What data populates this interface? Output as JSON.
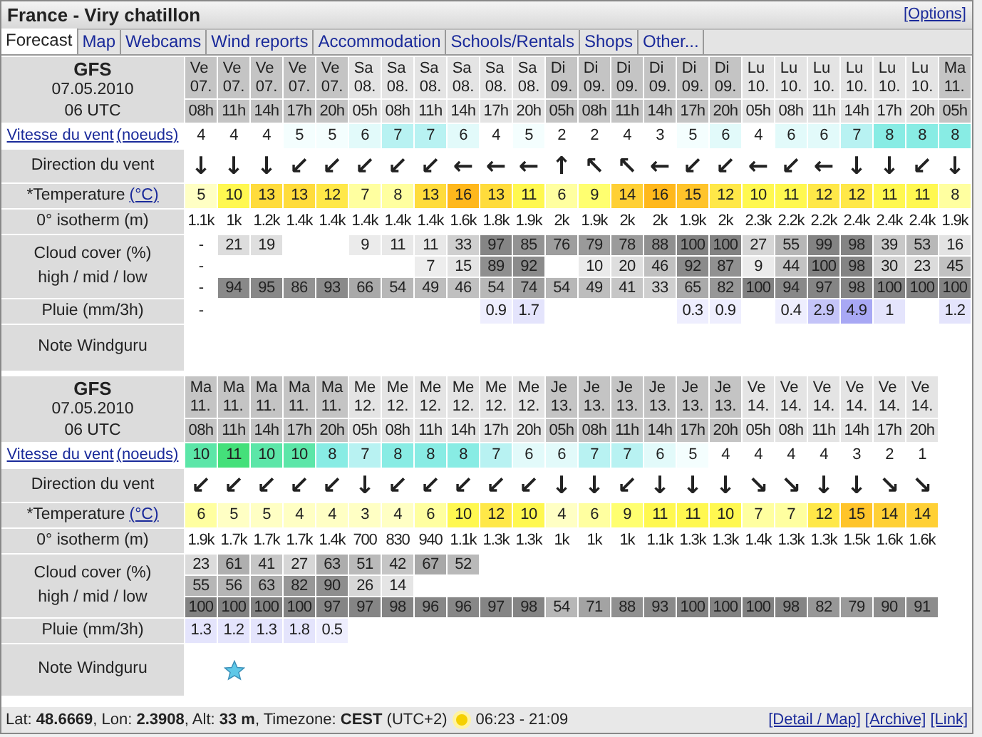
{
  "title": "France - Viry chatillon",
  "options_link": "[Options]",
  "tabs": [
    {
      "label": "Forecast",
      "selected": true
    },
    {
      "label": "Map",
      "selected": false
    },
    {
      "label": "Webcams",
      "selected": false
    },
    {
      "label": "Wind reports",
      "selected": false
    },
    {
      "label": "Accommodation",
      "selected": false
    },
    {
      "label": "Schools/Rentals",
      "selected": false
    },
    {
      "label": "Shops",
      "selected": false
    },
    {
      "label": "Other...",
      "selected": false
    }
  ],
  "blocks": [
    {
      "model": "GFS",
      "date": "07.05.2010",
      "run": "06 UTC",
      "labels": {
        "wind_speed": "Vitesse du vent",
        "wind_unit": "(noeuds)",
        "wind_direction": "Direction du vent",
        "temperature": "*Temperature",
        "temperature_unit": "(°C)",
        "isotherm": "0° isotherm (m)",
        "cloud": "Cloud cover (%)",
        "cloud_levels": "high / mid / low",
        "rain": "Pluie (mm/3h)",
        "note": "Note Windguru"
      },
      "columns": [
        {
          "day": "Ve",
          "date": "07.",
          "hour": "08h",
          "wind_speed": "4",
          "arrow": "↓",
          "temperature": "5",
          "isotherm": "1.1k",
          "cloud_high": "-",
          "cloud_mid": "-",
          "cloud_low": "-",
          "rain": "-"
        },
        {
          "day": "Ve",
          "date": "07.",
          "hour": "11h",
          "wind_speed": "4",
          "arrow": "↓",
          "temperature": "10",
          "isotherm": "1k",
          "cloud_high": "21",
          "cloud_low": "94"
        },
        {
          "day": "Ve",
          "date": "07.",
          "hour": "14h",
          "wind_speed": "4",
          "arrow": "↓",
          "temperature": "13",
          "isotherm": "1.2k",
          "cloud_high": "19",
          "cloud_low": "95"
        },
        {
          "day": "Ve",
          "date": "07.",
          "hour": "17h",
          "wind_speed": "5",
          "arrow": "↙",
          "temperature": "13",
          "isotherm": "1.4k",
          "cloud_low": "86"
        },
        {
          "day": "Ve",
          "date": "07.",
          "hour": "20h",
          "wind_speed": "5",
          "arrow": "↙",
          "temperature": "12",
          "isotherm": "1.4k",
          "cloud_low": "93"
        },
        {
          "day": "Sa",
          "date": "08.",
          "hour": "05h",
          "wind_speed": "6",
          "arrow": "↙",
          "temperature": "7",
          "isotherm": "1.4k",
          "cloud_high": "9",
          "cloud_low": "66"
        },
        {
          "day": "Sa",
          "date": "08.",
          "hour": "08h",
          "wind_speed": "7",
          "arrow": "↙",
          "temperature": "8",
          "isotherm": "1.4k",
          "cloud_high": "11",
          "cloud_low": "54"
        },
        {
          "day": "Sa",
          "date": "08.",
          "hour": "11h",
          "wind_speed": "7",
          "arrow": "↙",
          "temperature": "13",
          "isotherm": "1.4k",
          "cloud_high": "11",
          "cloud_mid": "7",
          "cloud_low": "49"
        },
        {
          "day": "Sa",
          "date": "08.",
          "hour": "14h",
          "wind_speed": "6",
          "arrow": "←",
          "temperature": "16",
          "isotherm": "1.6k",
          "cloud_high": "33",
          "cloud_mid": "15",
          "cloud_low": "46"
        },
        {
          "day": "Sa",
          "date": "08.",
          "hour": "17h",
          "wind_speed": "4",
          "arrow": "←",
          "temperature": "13",
          "isotherm": "1.8k",
          "cloud_high": "97",
          "cloud_mid": "89",
          "cloud_low": "54",
          "rain": "0.9"
        },
        {
          "day": "Sa",
          "date": "08.",
          "hour": "20h",
          "wind_speed": "5",
          "arrow": "←",
          "temperature": "11",
          "isotherm": "1.9k",
          "cloud_high": "85",
          "cloud_mid": "92",
          "cloud_low": "74",
          "rain": "1.7"
        },
        {
          "day": "Di",
          "date": "09.",
          "hour": "05h",
          "wind_speed": "2",
          "arrow": "↑",
          "temperature": "6",
          "isotherm": "2k",
          "cloud_high": "76",
          "cloud_low": "54"
        },
        {
          "day": "Di",
          "date": "09.",
          "hour": "08h",
          "wind_speed": "2",
          "arrow": "↖",
          "temperature": "9",
          "isotherm": "1.9k",
          "cloud_high": "79",
          "cloud_mid": "10",
          "cloud_low": "49"
        },
        {
          "day": "Di",
          "date": "09.",
          "hour": "11h",
          "wind_speed": "4",
          "arrow": "↖",
          "temperature": "14",
          "isotherm": "2k",
          "cloud_high": "78",
          "cloud_mid": "20",
          "cloud_low": "41"
        },
        {
          "day": "Di",
          "date": "09.",
          "hour": "14h",
          "wind_speed": "3",
          "arrow": "←",
          "temperature": "16",
          "isotherm": "2k",
          "cloud_high": "88",
          "cloud_mid": "46",
          "cloud_low": "33"
        },
        {
          "day": "Di",
          "date": "09.",
          "hour": "17h",
          "wind_speed": "5",
          "arrow": "↙",
          "temperature": "15",
          "isotherm": "1.9k",
          "cloud_high": "100",
          "cloud_mid": "92",
          "cloud_low": "65",
          "rain": "0.3"
        },
        {
          "day": "Di",
          "date": "09.",
          "hour": "20h",
          "wind_speed": "6",
          "arrow": "↙",
          "temperature": "12",
          "isotherm": "2k",
          "cloud_high": "100",
          "cloud_mid": "87",
          "cloud_low": "82",
          "rain": "0.9"
        },
        {
          "day": "Lu",
          "date": "10.",
          "hour": "05h",
          "wind_speed": "4",
          "arrow": "←",
          "temperature": "10",
          "isotherm": "2.3k",
          "cloud_high": "27",
          "cloud_mid": "9",
          "cloud_low": "100"
        },
        {
          "day": "Lu",
          "date": "10.",
          "hour": "08h",
          "wind_speed": "6",
          "arrow": "↙",
          "temperature": "11",
          "isotherm": "2.2k",
          "cloud_high": "55",
          "cloud_mid": "44",
          "cloud_low": "94",
          "rain": "0.4"
        },
        {
          "day": "Lu",
          "date": "10.",
          "hour": "11h",
          "wind_speed": "6",
          "arrow": "←",
          "temperature": "12",
          "isotherm": "2.2k",
          "cloud_high": "99",
          "cloud_mid": "100",
          "cloud_low": "97",
          "rain": "2.9"
        },
        {
          "day": "Lu",
          "date": "10.",
          "hour": "14h",
          "wind_speed": "7",
          "arrow": "↓",
          "temperature": "12",
          "isotherm": "2.4k",
          "cloud_high": "98",
          "cloud_mid": "98",
          "cloud_low": "98",
          "rain": "4.9"
        },
        {
          "day": "Lu",
          "date": "10.",
          "hour": "17h",
          "wind_speed": "8",
          "arrow": "↓",
          "temperature": "11",
          "isotherm": "2.4k",
          "cloud_high": "39",
          "cloud_mid": "30",
          "cloud_low": "100",
          "rain": "1"
        },
        {
          "day": "Lu",
          "date": "10.",
          "hour": "20h",
          "wind_speed": "8",
          "arrow": "↙",
          "temperature": "11",
          "isotherm": "2.4k",
          "cloud_high": "53",
          "cloud_mid": "23",
          "cloud_low": "100"
        },
        {
          "day": "Ma",
          "date": "11.",
          "hour": "05h",
          "wind_speed": "8",
          "arrow": "↓",
          "temperature": "8",
          "isotherm": "1.9k",
          "cloud_high": "16",
          "cloud_mid": "45",
          "cloud_low": "100",
          "rain": "1.2"
        }
      ]
    },
    {
      "model": "GFS",
      "date": "07.05.2010",
      "run": "06 UTC",
      "labels": {
        "wind_speed": "Vitesse du vent",
        "wind_unit": "(noeuds)",
        "wind_direction": "Direction du vent",
        "temperature": "*Temperature",
        "temperature_unit": "(°C)",
        "isotherm": "0° isotherm (m)",
        "cloud": "Cloud cover (%)",
        "cloud_levels": "high / mid / low",
        "rain": "Pluie (mm/3h)",
        "note": "Note Windguru"
      },
      "columns": [
        {
          "day": "Ma",
          "date": "11.",
          "hour": "08h",
          "wind_speed": "10",
          "arrow": "↙",
          "temperature": "6",
          "isotherm": "1.9k",
          "cloud_high": "23",
          "cloud_mid": "55",
          "cloud_low": "100",
          "rain": "1.3"
        },
        {
          "day": "Ma",
          "date": "11.",
          "hour": "11h",
          "wind_speed": "11",
          "arrow": "↙",
          "temperature": "5",
          "isotherm": "1.7k",
          "cloud_high": "61",
          "cloud_mid": "56",
          "cloud_low": "100",
          "rain": "1.2"
        },
        {
          "day": "Ma",
          "date": "11.",
          "hour": "14h",
          "wind_speed": "10",
          "arrow": "↙",
          "temperature": "5",
          "isotherm": "1.7k",
          "cloud_high": "41",
          "cloud_mid": "63",
          "cloud_low": "100",
          "rain": "1.3"
        },
        {
          "day": "Ma",
          "date": "11.",
          "hour": "17h",
          "wind_speed": "10",
          "arrow": "↙",
          "temperature": "4",
          "isotherm": "1.7k",
          "cloud_high": "27",
          "cloud_mid": "82",
          "cloud_low": "100",
          "rain": "1.8"
        },
        {
          "day": "Ma",
          "date": "11.",
          "hour": "20h",
          "wind_speed": "8",
          "arrow": "↙",
          "temperature": "4",
          "isotherm": "1.4k",
          "cloud_high": "63",
          "cloud_mid": "90",
          "cloud_low": "97",
          "rain": "0.5"
        },
        {
          "day": "Me",
          "date": "12.",
          "hour": "05h",
          "wind_speed": "7",
          "arrow": "↓",
          "temperature": "3",
          "isotherm": "700",
          "cloud_high": "51",
          "cloud_mid": "26",
          "cloud_low": "97"
        },
        {
          "day": "Me",
          "date": "12.",
          "hour": "08h",
          "wind_speed": "8",
          "arrow": "↙",
          "temperature": "4",
          "isotherm": "830",
          "cloud_high": "42",
          "cloud_mid": "14",
          "cloud_low": "98"
        },
        {
          "day": "Me",
          "date": "12.",
          "hour": "11h",
          "wind_speed": "8",
          "arrow": "↙",
          "temperature": "6",
          "isotherm": "940",
          "cloud_high": "67",
          "cloud_low": "96"
        },
        {
          "day": "Me",
          "date": "12.",
          "hour": "14h",
          "wind_speed": "8",
          "arrow": "↙",
          "temperature": "10",
          "isotherm": "1.1k",
          "cloud_high": "52",
          "cloud_low": "96"
        },
        {
          "day": "Me",
          "date": "12.",
          "hour": "17h",
          "wind_speed": "7",
          "arrow": "↙",
          "temperature": "12",
          "isotherm": "1.3k",
          "cloud_low": "97"
        },
        {
          "day": "Me",
          "date": "12.",
          "hour": "20h",
          "wind_speed": "6",
          "arrow": "↙",
          "temperature": "10",
          "isotherm": "1.3k",
          "cloud_low": "98"
        },
        {
          "day": "Je",
          "date": "13.",
          "hour": "05h",
          "wind_speed": "6",
          "arrow": "↓",
          "temperature": "4",
          "isotherm": "1k",
          "cloud_low": "54"
        },
        {
          "day": "Je",
          "date": "13.",
          "hour": "08h",
          "wind_speed": "7",
          "arrow": "↓",
          "temperature": "6",
          "isotherm": "1k",
          "cloud_low": "71"
        },
        {
          "day": "Je",
          "date": "13.",
          "hour": "11h",
          "wind_speed": "7",
          "arrow": "↙",
          "temperature": "9",
          "isotherm": "1k",
          "cloud_low": "88"
        },
        {
          "day": "Je",
          "date": "13.",
          "hour": "14h",
          "wind_speed": "6",
          "arrow": "↓",
          "temperature": "11",
          "isotherm": "1.1k",
          "cloud_low": "93"
        },
        {
          "day": "Je",
          "date": "13.",
          "hour": "17h",
          "wind_speed": "5",
          "arrow": "↓",
          "temperature": "11",
          "isotherm": "1.3k",
          "cloud_low": "100"
        },
        {
          "day": "Je",
          "date": "13.",
          "hour": "20h",
          "wind_speed": "4",
          "arrow": "↓",
          "temperature": "10",
          "isotherm": "1.3k",
          "cloud_low": "100"
        },
        {
          "day": "Ve",
          "date": "14.",
          "hour": "05h",
          "wind_speed": "4",
          "arrow": "↘",
          "temperature": "7",
          "isotherm": "1.4k",
          "cloud_low": "100"
        },
        {
          "day": "Ve",
          "date": "14.",
          "hour": "08h",
          "wind_speed": "4",
          "arrow": "↘",
          "temperature": "7",
          "isotherm": "1.3k",
          "cloud_low": "98"
        },
        {
          "day": "Ve",
          "date": "14.",
          "hour": "11h",
          "wind_speed": "4",
          "arrow": "↓",
          "temperature": "12",
          "isotherm": "1.3k",
          "cloud_low": "82"
        },
        {
          "day": "Ve",
          "date": "14.",
          "hour": "14h",
          "wind_speed": "3",
          "arrow": "↓",
          "temperature": "15",
          "isotherm": "1.5k",
          "cloud_low": "79"
        },
        {
          "day": "Ve",
          "date": "14.",
          "hour": "17h",
          "wind_speed": "2",
          "arrow": "↘",
          "temperature": "14",
          "isotherm": "1.6k",
          "cloud_low": "90"
        },
        {
          "day": "Ve",
          "date": "14.",
          "hour": "20h",
          "wind_speed": "1",
          "arrow": "↘",
          "temperature": "14",
          "isotherm": "1.6k",
          "cloud_low": "91"
        }
      ],
      "note_cells": [
        {
          "starred": false
        },
        {
          "starred": true
        },
        {
          "starred": false
        },
        {
          "starred": false
        },
        {
          "starred": false
        },
        {
          "starred": false
        },
        {
          "starred": false
        },
        {
          "starred": false
        },
        {
          "starred": false
        },
        {
          "starred": false
        },
        {
          "starred": false
        },
        {
          "starred": false
        },
        {
          "starred": false
        },
        {
          "starred": false
        },
        {
          "starred": false
        },
        {
          "starred": false
        },
        {
          "starred": false
        },
        {
          "starred": false
        },
        {
          "starred": false
        },
        {
          "starred": false
        },
        {
          "starred": false
        },
        {
          "starred": false
        },
        {
          "starred": false
        }
      ]
    }
  ],
  "footer": {
    "location": "Lat: **48.6669**, Lon: **2.3908**, Alt: **33 m**, Timezone: **CEST** (UTC+2)",
    "sun_times": "06:23 - 21:09",
    "links": [
      "[Detail / Map]",
      "[Archive]",
      "[Link]"
    ]
  }
}
